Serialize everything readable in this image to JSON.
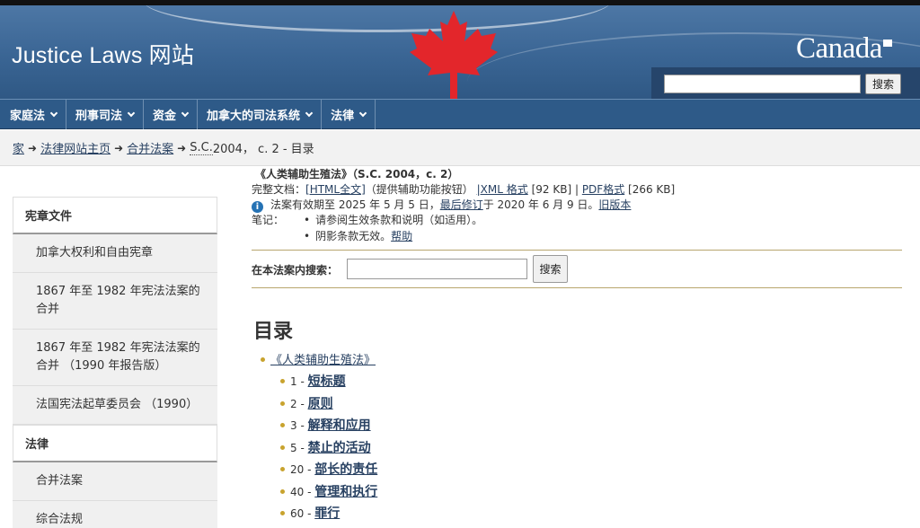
{
  "header": {
    "site_title": "Justice Laws 网站",
    "wordmark": "Canada",
    "search_placeholder": "",
    "search_button": "搜索"
  },
  "nav": {
    "items": [
      {
        "label": "家庭法"
      },
      {
        "label": "刑事司法"
      },
      {
        "label": "资金"
      },
      {
        "label": "加拿大的司法系统"
      },
      {
        "label": "法律"
      }
    ]
  },
  "breadcrumb": {
    "home": "家",
    "laws_home": "法律网站主页",
    "consolidated": "合并法案",
    "sc": "S.C.",
    "current": " 2004， c. 2 - 目录"
  },
  "sidebar": {
    "section1_title": "宪章文件",
    "section1_items": [
      "加拿大权利和自由宪章",
      "1867 年至 1982 年宪法法案的合并",
      "1867 年至 1982 年宪法法案的合并 （1990 年报告版）",
      "法国宪法起草委员会 （1990）"
    ],
    "section2_title": "法律",
    "section2_items": [
      "合并法案",
      "综合法规"
    ]
  },
  "main": {
    "act_title": "《人类辅助生殖法》（S.C. 2004，c. 2）",
    "full_doc_label": "完整文档：",
    "html_link": "[HTML全文]",
    "html_note": "（提供辅助功能按钮）",
    "xml_link": "|XML 格式",
    "xml_size": "[92 KB] |",
    "pdf_link": "PDF格式",
    "pdf_size": "[266 KB]",
    "currency_text": "法案有效期至 2025 年 5 月 5 日，",
    "last_amended_link": "最后修订",
    "amended_text": "于 2020 年 6 月 9 日。",
    "old_versions_link": "旧版本",
    "notes_label": "笔记：",
    "note1": "请参阅生效条款和说明（如适用）。",
    "note2_text": "阴影条款无效。",
    "note2_link": "帮助",
    "search_label": "在本法案内搜索：",
    "search_button": "搜索",
    "toc_title": "目录",
    "toc_root": "《人类辅助生殖法》",
    "toc_items": [
      {
        "num": "1 - ",
        "label": "短标题"
      },
      {
        "num": "2 - ",
        "label": "原则"
      },
      {
        "num": "3 - ",
        "label": "解释和应用"
      },
      {
        "num": "5 - ",
        "label": "禁止的活动"
      },
      {
        "num": "20 - ",
        "label": "部长的责任"
      },
      {
        "num": "40 - ",
        "label": "管理和执行"
      },
      {
        "num": "60 - ",
        "label": "罪行"
      }
    ]
  }
}
